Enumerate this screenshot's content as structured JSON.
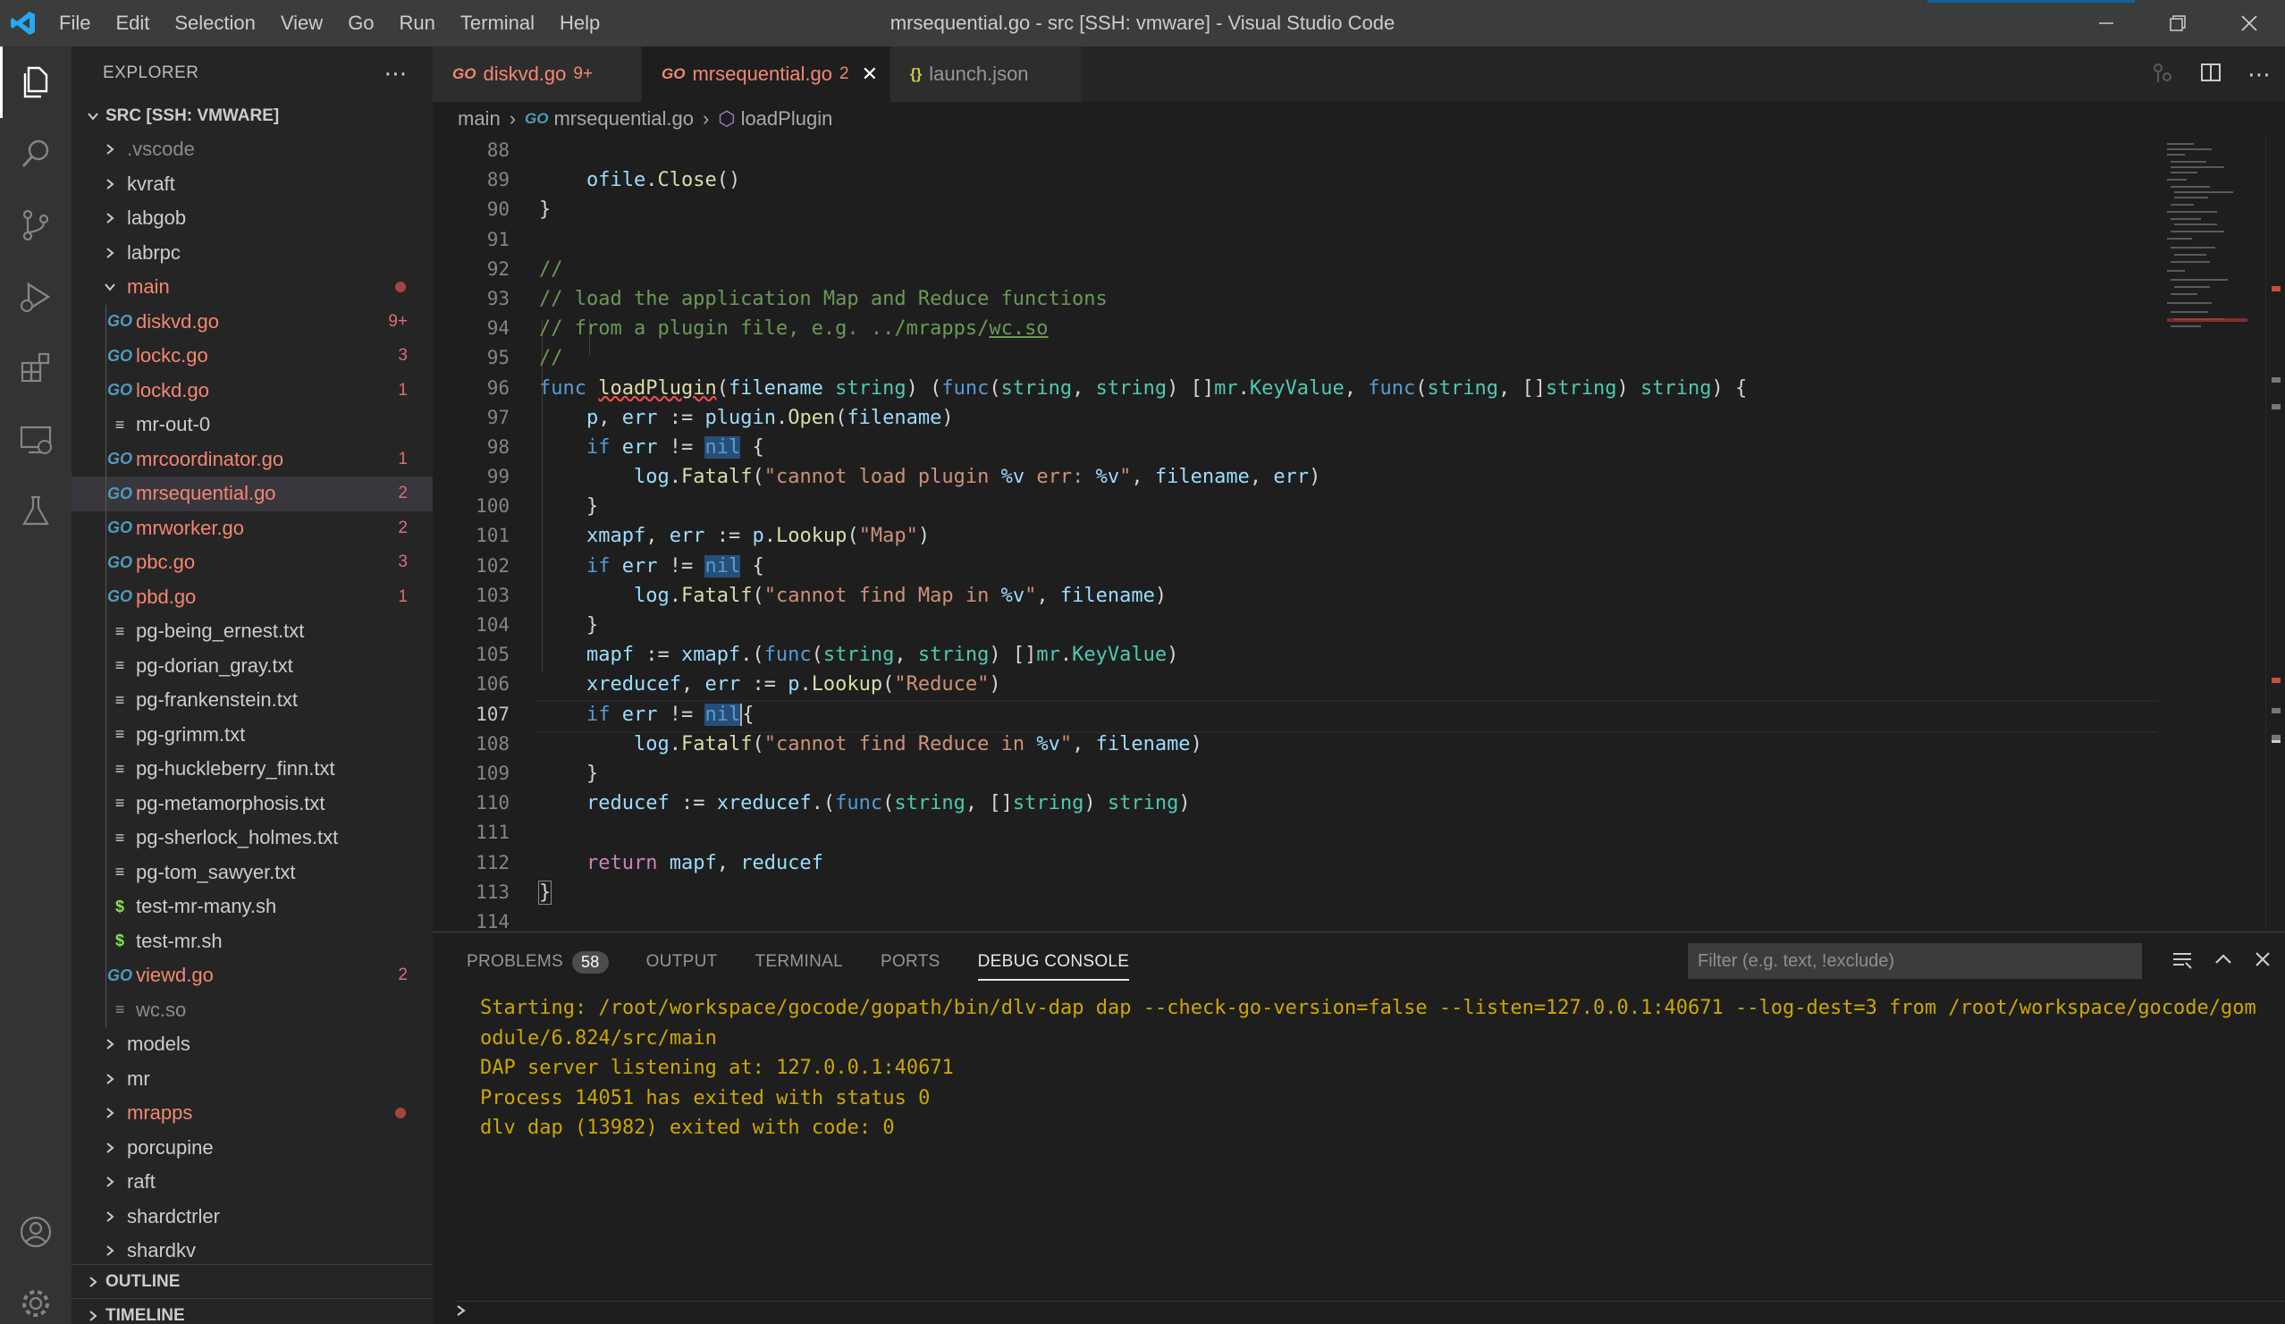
{
  "window": {
    "title": "mrsequential.go - src [SSH: vmware] - Visual Studio Code",
    "menu": [
      "File",
      "Edit",
      "Selection",
      "View",
      "Go",
      "Run",
      "Terminal",
      "Help"
    ]
  },
  "sidebar": {
    "header": "EXPLORER",
    "root": "SRC [SSH: VMWARE]",
    "items": [
      {
        "type": "folder",
        "name": ".vscode",
        "state": "dim"
      },
      {
        "type": "folder",
        "name": "kvraft"
      },
      {
        "type": "folder",
        "name": "labgob"
      },
      {
        "type": "folder",
        "name": "labrpc"
      },
      {
        "type": "folder-open",
        "name": "main",
        "state": "err",
        "dot": true
      },
      {
        "type": "go",
        "name": "diskvd.go",
        "badge": "9+"
      },
      {
        "type": "go",
        "name": "lockc.go",
        "badge": "3"
      },
      {
        "type": "go",
        "name": "lockd.go",
        "badge": "1"
      },
      {
        "type": "txt",
        "name": "mr-out-0"
      },
      {
        "type": "go",
        "name": "mrcoordinator.go",
        "badge": "1"
      },
      {
        "type": "go",
        "name": "mrsequential.go",
        "badge": "2",
        "selected": true
      },
      {
        "type": "go",
        "name": "mrworker.go",
        "badge": "2"
      },
      {
        "type": "go",
        "name": "pbc.go",
        "badge": "3"
      },
      {
        "type": "go",
        "name": "pbd.go",
        "badge": "1"
      },
      {
        "type": "txt",
        "name": "pg-being_ernest.txt"
      },
      {
        "type": "txt",
        "name": "pg-dorian_gray.txt"
      },
      {
        "type": "txt",
        "name": "pg-frankenstein.txt"
      },
      {
        "type": "txt",
        "name": "pg-grimm.txt"
      },
      {
        "type": "txt",
        "name": "pg-huckleberry_finn.txt"
      },
      {
        "type": "txt",
        "name": "pg-metamorphosis.txt"
      },
      {
        "type": "txt",
        "name": "pg-sherlock_holmes.txt"
      },
      {
        "type": "txt",
        "name": "pg-tom_sawyer.txt"
      },
      {
        "type": "sh",
        "name": "test-mr-many.sh"
      },
      {
        "type": "sh",
        "name": "test-mr.sh"
      },
      {
        "type": "go",
        "name": "viewd.go",
        "badge": "2"
      },
      {
        "type": "txt",
        "name": "wc.so",
        "state": "dim"
      },
      {
        "type": "folder",
        "name": "models"
      },
      {
        "type": "folder",
        "name": "mr"
      },
      {
        "type": "folder",
        "name": "mrapps",
        "state": "err",
        "dot": true
      },
      {
        "type": "folder",
        "name": "porcupine"
      },
      {
        "type": "folder",
        "name": "raft"
      },
      {
        "type": "folder",
        "name": "shardctrler"
      },
      {
        "type": "folder",
        "name": "shardkv"
      }
    ],
    "outline": "OUTLINE",
    "timeline": "TIMELINE"
  },
  "tabs": [
    {
      "name": "diskvd.go",
      "count": "9+",
      "active": false
    },
    {
      "name": "mrsequential.go",
      "count": "2",
      "active": true
    },
    {
      "name": "launch.json",
      "count": "",
      "active": false
    }
  ],
  "breadcrumb": {
    "folder": "main",
    "file": "mrsequential.go",
    "symbol": "loadPlugin"
  },
  "editor": {
    "current_line": 107,
    "line_numbers": [
      88,
      89,
      90,
      91,
      92,
      93,
      94,
      95,
      96,
      97,
      98,
      99,
      100,
      101,
      102,
      103,
      104,
      105,
      106,
      107,
      108,
      109,
      110,
      111,
      112,
      113,
      114
    ]
  },
  "panel": {
    "tabs": [
      "PROBLEMS",
      "OUTPUT",
      "TERMINAL",
      "PORTS",
      "DEBUG CONSOLE"
    ],
    "problems_count": "58",
    "active_tab": "DEBUG CONSOLE",
    "filter_placeholder": "Filter (e.g. text, !exclude)",
    "console_lines": [
      "Starting: /root/workspace/gocode/gopath/bin/dlv-dap dap --check-go-version=false --listen=127.0.0.1:40671 --log-dest=3 from /root/workspace/gocode/gomodule/6.824/src/main",
      "DAP server listening at: 127.0.0.1:40671",
      "Process 14051 has exited with status 0",
      "dlv dap (13982) exited with code: 0"
    ]
  },
  "colors": {
    "accent": "#007acc",
    "error": "#f48771",
    "console": "#cca700"
  }
}
